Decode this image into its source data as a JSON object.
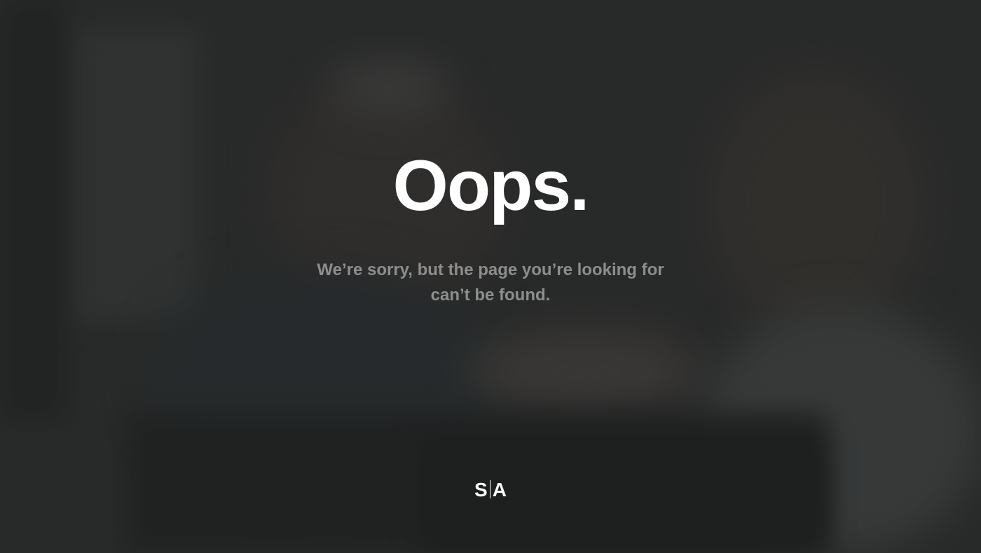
{
  "error": {
    "headline": "Oops.",
    "message": "We’re sorry, but the page you’re looking for can’t be found."
  },
  "logo": {
    "left": "S",
    "right": "A"
  },
  "colors": {
    "background": "#2f302f",
    "headline": "#ffffff",
    "message": "#8d8e8c"
  }
}
